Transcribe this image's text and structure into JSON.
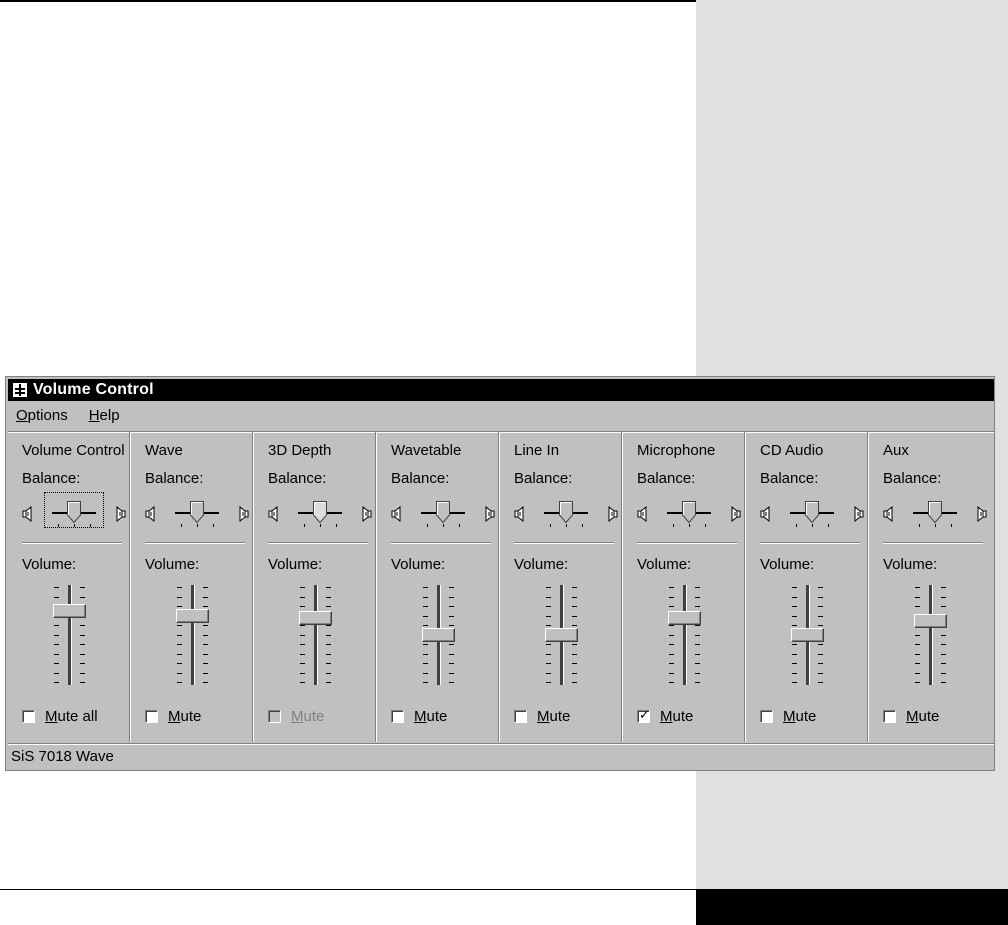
{
  "window": {
    "title": "Volume Control",
    "icon": "volume-control-icon"
  },
  "menu": [
    {
      "label_pre": "",
      "underlined": "O",
      "label_post": "ptions"
    },
    {
      "label_pre": "",
      "underlined": "H",
      "label_post": "elp"
    }
  ],
  "channels": [
    {
      "name": "Volume Control",
      "balance_label": "Balance:",
      "volume_label": "Volume:",
      "volume_level": 0.78,
      "mute_label_pre": "",
      "mute_underlined": "M",
      "mute_label_post": "ute all",
      "muted": false,
      "disabled": false,
      "focused": true
    },
    {
      "name": "Wave",
      "balance_label": "Balance:",
      "volume_label": "Volume:",
      "volume_level": 0.72,
      "mute_label_pre": "",
      "mute_underlined": "M",
      "mute_label_post": "ute",
      "muted": false,
      "disabled": false,
      "focused": false
    },
    {
      "name": "3D Depth",
      "balance_label": "Balance:",
      "volume_label": "Volume:",
      "volume_level": 0.7,
      "mute_label_pre": "",
      "mute_underlined": "M",
      "mute_label_post": "ute",
      "muted": false,
      "disabled": true,
      "focused": false
    },
    {
      "name": "Wavetable",
      "balance_label": "Balance:",
      "volume_label": "Volume:",
      "volume_level": 0.5,
      "mute_label_pre": "",
      "mute_underlined": "M",
      "mute_label_post": "ute",
      "muted": false,
      "disabled": false,
      "focused": false
    },
    {
      "name": "Line In",
      "balance_label": "Balance:",
      "volume_label": "Volume:",
      "volume_level": 0.5,
      "mute_label_pre": "",
      "mute_underlined": "M",
      "mute_label_post": "ute",
      "muted": false,
      "disabled": false,
      "focused": false
    },
    {
      "name": "Microphone",
      "balance_label": "Balance:",
      "volume_label": "Volume:",
      "volume_level": 0.7,
      "mute_label_pre": "",
      "mute_underlined": "M",
      "mute_label_post": "ute",
      "muted": true,
      "disabled": false,
      "focused": false
    },
    {
      "name": "CD Audio",
      "balance_label": "Balance:",
      "volume_label": "Volume:",
      "volume_level": 0.5,
      "mute_label_pre": "",
      "mute_underlined": "M",
      "mute_label_post": "ute",
      "muted": false,
      "disabled": false,
      "focused": false
    },
    {
      "name": "Aux",
      "balance_label": "Balance:",
      "volume_label": "Volume:",
      "volume_level": 0.66,
      "mute_label_pre": "",
      "mute_underlined": "M",
      "mute_label_post": "ute",
      "muted": false,
      "disabled": false,
      "focused": false
    }
  ],
  "status": {
    "text": "SiS 7018 Wave"
  },
  "colors": {
    "face": "#c0c0c0",
    "titlebar": "#000000",
    "side_panel": "#e0e0e0"
  }
}
